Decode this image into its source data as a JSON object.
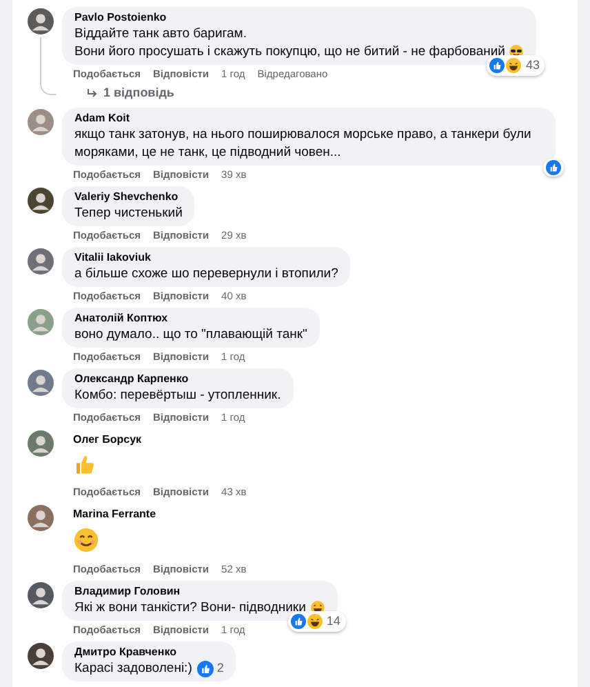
{
  "comments": [
    {
      "author": "Pavlo Postoienko",
      "kind": "text",
      "lines": [
        "Віддайте танк авто баригам.",
        "Вони його просушать і скажуть покупцю, що не битий - не фарбований"
      ],
      "trailing_emoji": {
        "kind": "sunglasses"
      },
      "reactions": {
        "kind": "corner",
        "types": [
          {
            "kind": "like"
          },
          {
            "kind": "haha"
          }
        ],
        "count": "43"
      },
      "actions": [
        "Подобається",
        "Відповісти"
      ],
      "time": "1 год",
      "edited": "Відредаговано",
      "replies": "1 відповідь"
    },
    {
      "author": "Adam Koit",
      "kind": "text",
      "lines": [
        "якщо танк затонув, на нього поширювалося морське право, а танкери були моряками, це не танк, це підводний човен..."
      ],
      "reactions": {
        "kind": "corner",
        "types": [
          {
            "kind": "like"
          }
        ]
      },
      "actions": [
        "Подобається",
        "Відповісти"
      ],
      "time": "39 хв"
    },
    {
      "author": "Valeriy Shevchenko",
      "kind": "text",
      "lines": [
        "Тепер чистенький"
      ],
      "actions": [
        "Подобається",
        "Відповісти"
      ],
      "time": "29 хв"
    },
    {
      "author": "Vitalii Iakoviuk",
      "kind": "text",
      "lines": [
        "а більше схоже шо перевернули і втопили?"
      ],
      "actions": [
        "Подобається",
        "Відповісти"
      ],
      "time": "40 хв"
    },
    {
      "author": "Анатолій Коптюх",
      "kind": "text",
      "lines": [
        "воно думало.. що то \"плавающій танк\""
      ],
      "actions": [
        "Подобається",
        "Відповісти"
      ],
      "time": "1 год"
    },
    {
      "author": "Олександр Карпенко",
      "kind": "text",
      "lines": [
        "Комбо: перевёртыш - утопленник."
      ],
      "actions": [
        "Подобається",
        "Відповісти"
      ],
      "time": "1 год"
    },
    {
      "author": "Олег Борсук",
      "kind": "emoji",
      "emoji": {
        "kind": "thumbs-up"
      },
      "actions": [
        "Подобається",
        "Відповісти"
      ],
      "time": "43 хв"
    },
    {
      "author": "Marina Ferrante",
      "kind": "emoji",
      "emoji": {
        "kind": "smile"
      },
      "actions": [
        "Подобається",
        "Відповісти"
      ],
      "time": "52 хв"
    },
    {
      "author": "Владимир Головин",
      "kind": "text",
      "lines": [
        "Які ж вони танкісти? Вони- підводники"
      ],
      "trailing_emoji": {
        "kind": "laugh"
      },
      "reactions": {
        "kind": "corner",
        "types": [
          {
            "kind": "like"
          },
          {
            "kind": "haha"
          }
        ],
        "count": "14"
      },
      "actions": [
        "Подобається",
        "Відповісти"
      ],
      "time": "1 год"
    },
    {
      "author": "Дмитро Кравченко",
      "kind": "text",
      "lines": [
        "Карасі задоволені:)"
      ],
      "reactions": {
        "kind": "inline",
        "types": [
          {
            "kind": "like"
          }
        ],
        "count": "2"
      }
    }
  ]
}
